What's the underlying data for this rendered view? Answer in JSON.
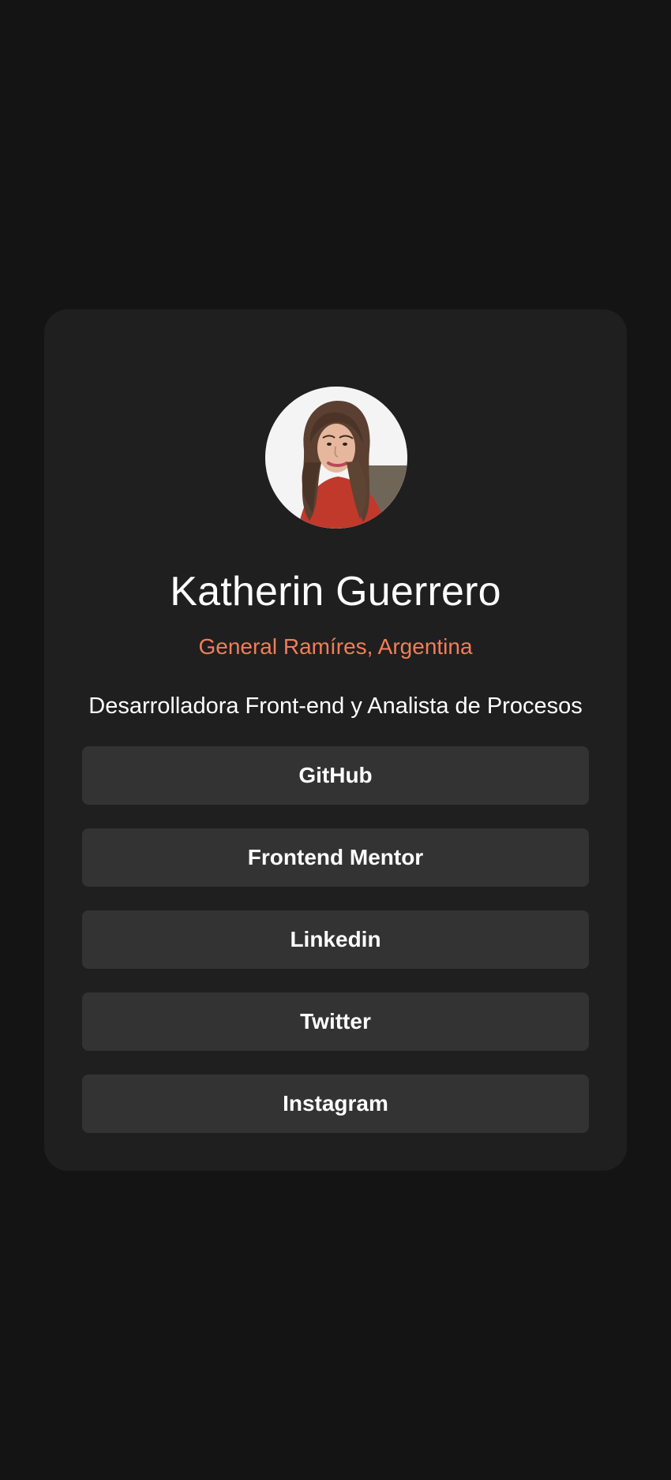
{
  "profile": {
    "name": "Katherin Guerrero",
    "location": "General Ramíres, Argentina",
    "bio": "Desarrolladora Front-end y Analista de Procesos"
  },
  "links": [
    {
      "label": "GitHub"
    },
    {
      "label": "Frontend Mentor"
    },
    {
      "label": "Linkedin"
    },
    {
      "label": "Twitter"
    },
    {
      "label": "Instagram"
    }
  ],
  "colors": {
    "page_background": "#141414",
    "card_background": "#1f1f1f",
    "button_background": "#333333",
    "accent": "#f07f58",
    "text": "#ffffff"
  }
}
